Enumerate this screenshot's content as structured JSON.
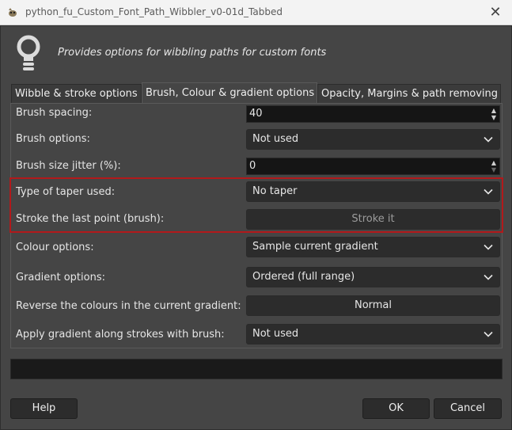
{
  "window": {
    "title": "python_fu_Custom_Font_Path_Wibbler_v0-01d_Tabbed",
    "close_icon": "close-icon"
  },
  "header": {
    "description": "Provides options for wibbling paths for custom fonts",
    "icon": "lightbulb-icon"
  },
  "tabs": [
    {
      "label": "Wibble & stroke options",
      "active": false
    },
    {
      "label": "Brush, Colour & gradient options",
      "active": true
    },
    {
      "label": "Opacity, Margins & path removing",
      "active": false
    }
  ],
  "form": {
    "brush_spacing": {
      "label": "Brush spacing:",
      "value": "40"
    },
    "brush_options": {
      "label": "Brush options:",
      "value": "Not used"
    },
    "brush_size_jitter": {
      "label": "Brush size jitter (%):",
      "value": "0"
    },
    "taper_type": {
      "label": "Type of taper used:",
      "value": "No taper"
    },
    "stroke_last_point": {
      "label": "Stroke the last point (brush):",
      "button": "Stroke it"
    },
    "colour_options": {
      "label": "Colour options:",
      "value": "Sample current gradient"
    },
    "gradient_options": {
      "label": "Gradient options:",
      "value": "Ordered (full range)"
    },
    "reverse_colours": {
      "label": "Reverse the colours in the current gradient:",
      "button": "Normal"
    },
    "apply_gradient": {
      "label": "Apply gradient along strokes with brush:",
      "value": "Not used"
    }
  },
  "buttons": {
    "help": "Help",
    "ok": "OK",
    "cancel": "Cancel"
  },
  "colors": {
    "background": "#454545",
    "highlight": "#b2191b",
    "titlebar": "#f3f3f3"
  }
}
